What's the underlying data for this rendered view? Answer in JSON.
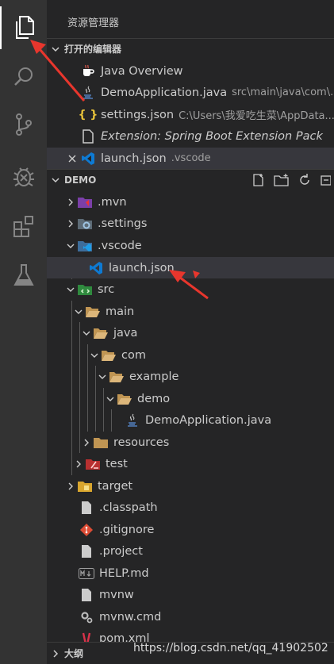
{
  "sidebar": {
    "title": "资源管理器",
    "open_editors": {
      "header": "打开的编辑器",
      "items": [
        {
          "label": "Java Overview",
          "desc": ""
        },
        {
          "label": "DemoApplication.java",
          "desc": "src\\main\\java\\com\\..."
        },
        {
          "label": "settings.json",
          "desc": "C:\\Users\\我爱吃生菜\\AppData..."
        },
        {
          "label": "Extension: Spring Boot Extension Pack",
          "desc": ""
        },
        {
          "label": "launch.json",
          "desc": ".vscode"
        }
      ]
    },
    "demo": {
      "header": "DEMO",
      "tree": [
        ".mvn",
        ".settings",
        ".vscode",
        "launch.json",
        "src",
        "main",
        "java",
        "com",
        "example",
        "demo",
        "DemoApplication.java",
        "resources",
        "test",
        "target",
        ".classpath",
        ".gitignore",
        ".project",
        "HELP.md",
        "mvnw",
        "mvnw.cmd",
        "pom.xml"
      ]
    },
    "outline_header": "大纲"
  },
  "watermark": "https://blog.csdn.net/qq_41902502",
  "colors": {
    "accent": "#0e7ad3",
    "annotation": "#e8362d"
  }
}
